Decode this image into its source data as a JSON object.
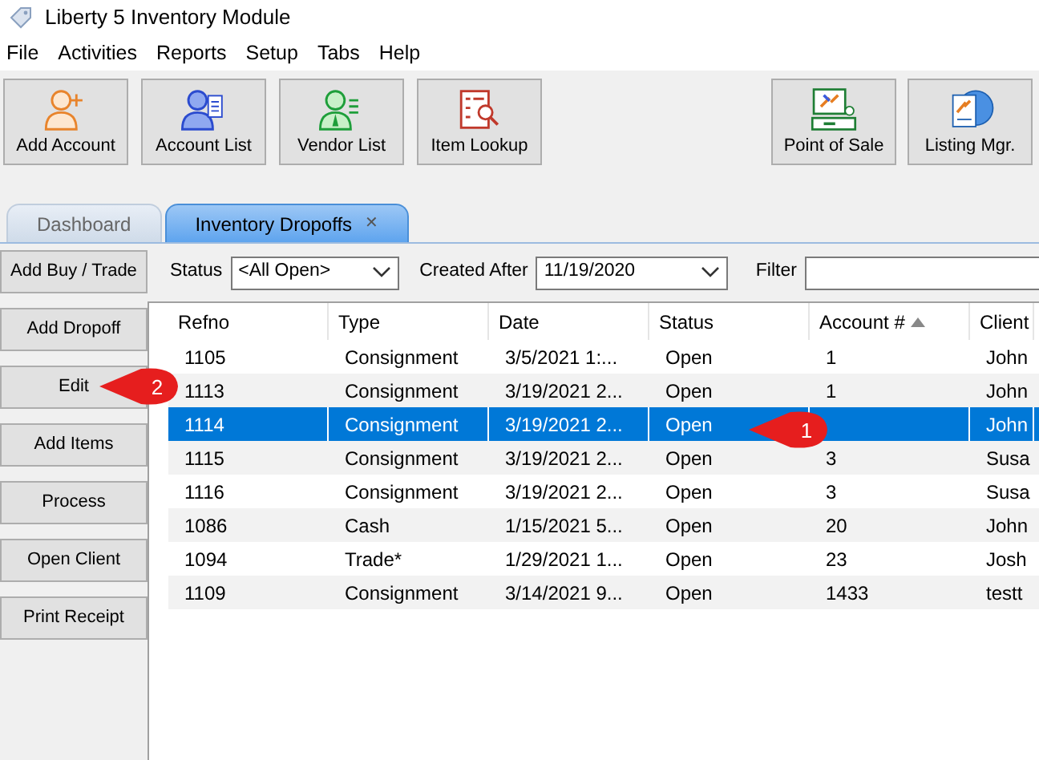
{
  "window": {
    "title": "Liberty 5 Inventory Module"
  },
  "menu": [
    "File",
    "Activities",
    "Reports",
    "Setup",
    "Tabs",
    "Help"
  ],
  "toolbar": [
    {
      "label": "Add Account",
      "kind": "add-person"
    },
    {
      "label": "Account List",
      "kind": "person-list"
    },
    {
      "label": "Vendor List",
      "kind": "vendor"
    },
    {
      "label": "Item Lookup",
      "kind": "lookup"
    }
  ],
  "toolbar_right": [
    {
      "label": "Point of Sale",
      "kind": "register"
    },
    {
      "label": "Listing Mgr.",
      "kind": "globe"
    }
  ],
  "tabs": [
    {
      "label": "Dashboard",
      "selected": false
    },
    {
      "label": "Inventory Dropoffs",
      "selected": true,
      "close": "✕"
    }
  ],
  "actions": [
    "Add Buy / Trade",
    "Add Dropoff",
    "Edit",
    "Add Items",
    "Process",
    "Open Client",
    "Print Receipt"
  ],
  "filters": {
    "status_label": "Status",
    "status_value": "<All Open>",
    "created_label": "Created After",
    "created_value": "11/19/2020",
    "filter_label": "Filter"
  },
  "table": {
    "columns": [
      {
        "label": "Refno"
      },
      {
        "label": "Type"
      },
      {
        "label": "Date"
      },
      {
        "label": "Status"
      },
      {
        "label": "Account #",
        "sorted": true
      },
      {
        "label": "Client"
      }
    ],
    "rows": [
      {
        "cells": [
          "1105",
          "Consignment",
          "3/5/2021 1:...",
          "Open",
          "1",
          "John"
        ],
        "selected": false
      },
      {
        "cells": [
          "1113",
          "Consignment",
          "3/19/2021 2...",
          "Open",
          "1",
          "John"
        ],
        "selected": false
      },
      {
        "cells": [
          "1114",
          "Consignment",
          "3/19/2021 2...",
          "Open",
          null,
          "John"
        ],
        "selected": true
      },
      {
        "cells": [
          "1115",
          "Consignment",
          "3/19/2021 2...",
          "Open",
          "3",
          "Susa"
        ],
        "selected": false
      },
      {
        "cells": [
          "1116",
          "Consignment",
          "3/19/2021 2...",
          "Open",
          "3",
          "Susa"
        ],
        "selected": false
      },
      {
        "cells": [
          "1086",
          "Cash",
          "1/15/2021 5...",
          "Open",
          "20",
          "John"
        ],
        "selected": false
      },
      {
        "cells": [
          "1094",
          "Trade*",
          "1/29/2021 1...",
          "Open",
          "23",
          "Josh"
        ],
        "selected": false
      },
      {
        "cells": [
          "1109",
          "Consignment",
          "3/14/2021 9...",
          "Open",
          "1433",
          "testt"
        ],
        "selected": false
      }
    ]
  },
  "callouts": [
    {
      "label": "2"
    },
    {
      "label": "1"
    }
  ]
}
